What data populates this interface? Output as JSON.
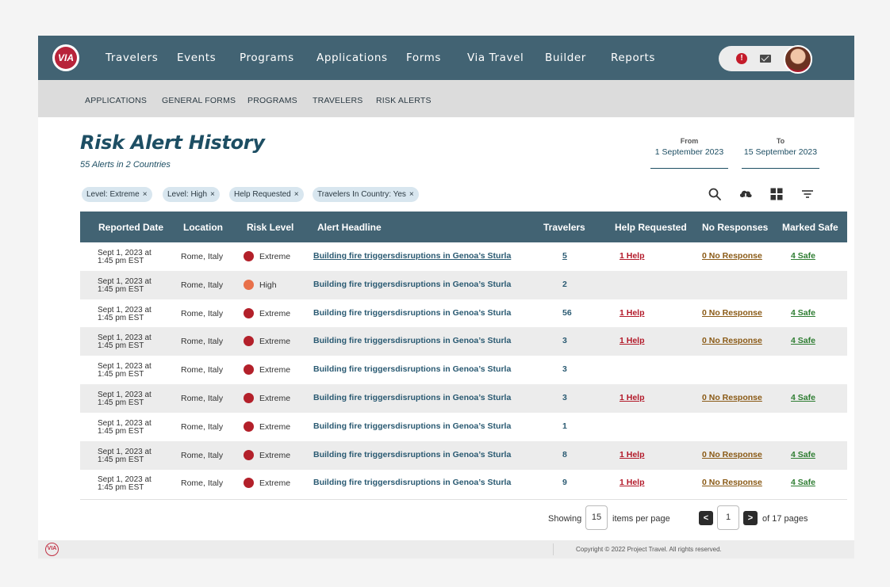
{
  "nav": {
    "logo_text": "VIA",
    "items": [
      "Travelers",
      "Events",
      "Programs",
      "Applications",
      "Forms",
      "Via Travel",
      "Builder",
      "Reports"
    ],
    "alert_glyph": "!"
  },
  "subnav": {
    "items": [
      "APPLICATIONS",
      "GENERAL FORMS",
      "PROGRAMS",
      "TRAVELERS",
      "RISK ALERTS"
    ]
  },
  "page": {
    "title": "Risk Alert History",
    "subtitle": "55 Alerts in 2 Countries",
    "from_label": "From",
    "from_value": "1 September 2023",
    "to_label": "To",
    "to_value": "15 September 2023"
  },
  "filters": [
    "Level: Extreme",
    "Level: High",
    "Help Requested",
    "Travelers In Country: Yes"
  ],
  "chip_close": "×",
  "toolbar_icons": [
    "search-icon",
    "cloud-download-icon",
    "grid-view-icon",
    "filter-icon"
  ],
  "table": {
    "headers": [
      "Reported Date",
      "Location",
      "Risk Level",
      "Alert Headline",
      "Travelers",
      "Help Requested",
      "No Responses",
      "Marked Safe"
    ],
    "rows": [
      {
        "date1": "Sept 1, 2023 at",
        "date2": "1:45 pm EST",
        "location": "Rome, Italy",
        "risk": "Extreme",
        "headline": "Building fire triggersdisruptions in Genoa’s Sturla",
        "travelers": "5",
        "help": "1 Help",
        "no_response": "0 No Response",
        "safe": "4 Safe"
      },
      {
        "date1": "Sept 1, 2023 at",
        "date2": "1:45 pm EST",
        "location": "Rome, Italy",
        "risk": "High",
        "headline": "Building fire triggersdisruptions in Genoa’s Sturla",
        "travelers": "2",
        "help": "",
        "no_response": "",
        "safe": ""
      },
      {
        "date1": "Sept 1, 2023 at",
        "date2": "1:45 pm EST",
        "location": "Rome, Italy",
        "risk": "Extreme",
        "headline": "Building fire triggersdisruptions in Genoa’s Sturla",
        "travelers": "56",
        "help": "1 Help",
        "no_response": "0 No Response",
        "safe": "4 Safe"
      },
      {
        "date1": "Sept 1, 2023 at",
        "date2": "1:45 pm EST",
        "location": "Rome, Italy",
        "risk": "Extreme",
        "headline": "Building fire triggersdisruptions in Genoa’s Sturla",
        "travelers": "3",
        "help": "1 Help",
        "no_response": "0 No Response",
        "safe": "4 Safe"
      },
      {
        "date1": "Sept 1, 2023 at",
        "date2": "1:45 pm EST",
        "location": "Rome, Italy",
        "risk": "Extreme",
        "headline": "Building fire triggersdisruptions in Genoa’s Sturla",
        "travelers": "3",
        "help": "",
        "no_response": "",
        "safe": ""
      },
      {
        "date1": "Sept 1, 2023 at",
        "date2": "1:45 pm EST",
        "location": "Rome, Italy",
        "risk": "Extreme",
        "headline": "Building fire triggersdisruptions in Genoa’s Sturla",
        "travelers": "3",
        "help": "1 Help",
        "no_response": "0 No Response",
        "safe": "4 Safe"
      },
      {
        "date1": "Sept 1, 2023 at",
        "date2": "1:45 pm EST",
        "location": "Rome, Italy",
        "risk": "Extreme",
        "headline": "Building fire triggersdisruptions in Genoa’s Sturla",
        "travelers": "1",
        "help": "",
        "no_response": "",
        "safe": ""
      },
      {
        "date1": "Sept 1, 2023 at",
        "date2": "1:45 pm EST",
        "location": "Rome, Italy",
        "risk": "Extreme",
        "headline": "Building fire triggersdisruptions in Genoa’s Sturla",
        "travelers": "8",
        "help": "1 Help",
        "no_response": "0 No Response",
        "safe": "4 Safe"
      },
      {
        "date1": "Sept 1, 2023 at",
        "date2": "1:45 pm EST",
        "location": "Rome, Italy",
        "risk": "Extreme",
        "headline": "Building fire triggersdisruptions in Genoa’s Sturla",
        "travelers": "9",
        "help": "1 Help",
        "no_response": "0 No Response",
        "safe": "4 Safe"
      }
    ]
  },
  "risk_colors": {
    "Extreme": "#b3202a",
    "High": "#e8704a"
  },
  "pager": {
    "showing_label": "Showing",
    "per_page": "15",
    "items_label": "items per page",
    "current_page": "1",
    "prev_glyph": "<",
    "next_glyph": ">",
    "total_label": "of 17 pages"
  },
  "footer": {
    "logo_text": "VIA",
    "copyright": "Copyright © 2022 Project Travel. All rights reserved."
  }
}
